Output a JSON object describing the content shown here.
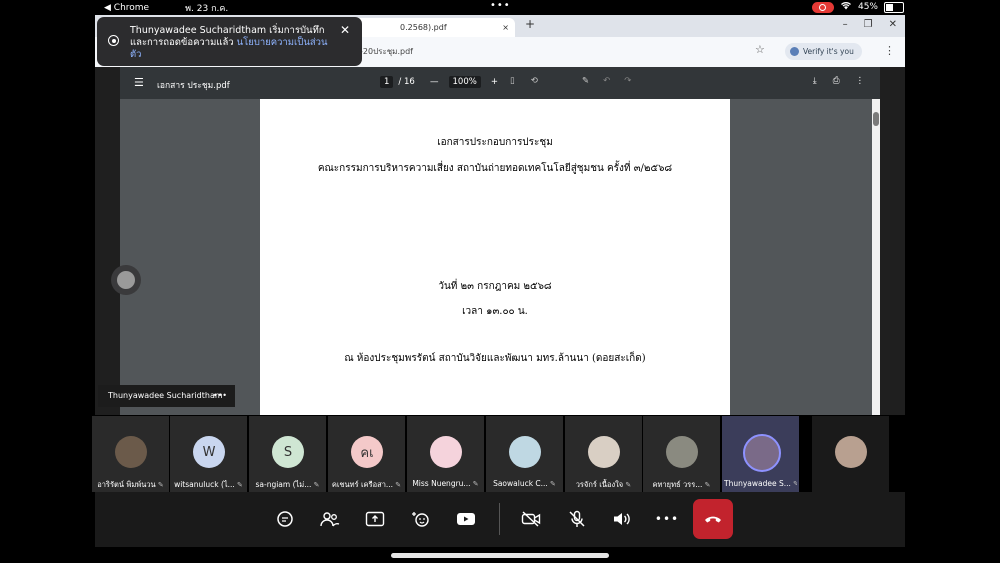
{
  "status_bar": {
    "app": "Chrome",
    "date": "พ. 23 ก.ค.",
    "dots": "•••",
    "battery": "45%",
    "battery_level": 0.45
  },
  "browser": {
    "tab_title_fragment": "0.2568).pdf",
    "tab_close": "×",
    "new_tab": "+",
    "minimize": "–",
    "maximize": "❐",
    "close": "✕",
    "url_fragment": "-20ประชุม.pdf",
    "verify_label": "Verify it's you"
  },
  "pdf_toolbar": {
    "filename": "เอกสาร ประชุม.pdf",
    "current_page": "1",
    "total_pages": "/ 16",
    "zoom": "100%",
    "zoom_out": "—",
    "zoom_in": "+"
  },
  "pdf_page": {
    "line1": "เอกสารประกอบการประชุม",
    "line2": "คณะกรรมการบริหารความเสี่ยง สถาบันถ่ายทอดเทคโนโลยีสู่ชุมชน ครั้งที่ ๓/๒๕๖๘",
    "line3": "วันที่ ๒๓ กรกฎาคม ๒๕๖๘",
    "line4": "เวลา ๑๓.๐๐ น.",
    "line5": "ณ ห้องประชุมพรรัตน์ สถาบันวิจัยและพัฒนา มทร.ล้านนา (ดอยสะเก็ด)"
  },
  "notification": {
    "text": "Thunyawadee Sucharidtham เริ่มการบันทึกและการถอดข้อความแล้ว",
    "link": "นโยบายความเป็นส่วนตัว",
    "close": "✕"
  },
  "presenter": {
    "name": "Thunyawadee Sucharidtham",
    "more": "•••"
  },
  "participants": [
    {
      "label": "อาริรัตน์ พิมพ์นวน",
      "initial": "",
      "color": "#6b5a4a"
    },
    {
      "label": "witsanuluck (ไ...",
      "initial": "W",
      "color": "#c9d6ef"
    },
    {
      "label": "sa-ngiam (ไม่...",
      "initial": "S",
      "color": "#cfe6d3"
    },
    {
      "label": "คเชนทร์ เครือสา...",
      "initial": "คเ",
      "color": "#f4c9c9"
    },
    {
      "label": "Miss Nuengru...",
      "initial": "",
      "color": "#f5d3dc"
    },
    {
      "label": "Saowaluck C...",
      "initial": "",
      "color": "#bfd8e3"
    },
    {
      "label": "วรจักร์ เนื้องใจ",
      "initial": "",
      "color": "#d9cfc4"
    },
    {
      "label": "คทายุทธ์ วรร...",
      "initial": "",
      "color": "#8a8a80"
    },
    {
      "label": "Thunyawadee S...",
      "initial": "",
      "color": "#7a6a88"
    },
    {
      "label": "",
      "initial": "",
      "color": "#b8a090"
    }
  ],
  "controls": {
    "chat": "chat-icon",
    "people": "people-icon",
    "share": "share-screen-icon",
    "reactions": "reactions-icon",
    "video_view": "video-view-icon",
    "camera_off": "camera-off-icon",
    "mic_off": "mic-off-icon",
    "speaker": "speaker-icon",
    "more": "•••",
    "hangup": "hangup-icon"
  }
}
